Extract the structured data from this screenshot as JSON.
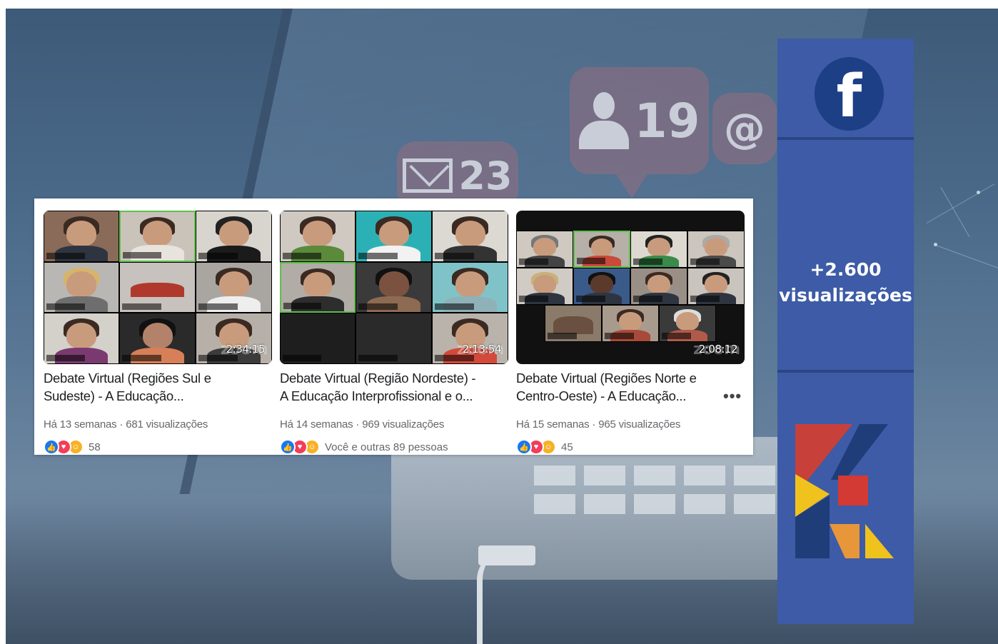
{
  "videos": [
    {
      "title_line1": "Debate Virtual (Regiões Sul e",
      "title_line2": "Sudeste) - A Educação...",
      "meta": "Há 13 semanas · 681 visualizações",
      "duration": "2:34:15",
      "reaction_count": "58"
    },
    {
      "title_line1": "Debate Virtual (Região Nordeste) -",
      "title_line2": "A Educação Interprofissional e o...",
      "meta": "Há 14 semanas · 969 visualizações",
      "duration": "2:13:54",
      "reaction_count": "Você e outras 89 pessoas"
    },
    {
      "title_line1": "Debate Virtual (Regiões Norte e",
      "title_line2": "Centro-Oeste) - A Educação...",
      "meta": "Há 15 semanas · 965 visualizações",
      "duration": "2:08:12",
      "reaction_count": "45"
    }
  ],
  "watermark": "zoom",
  "more_options": "•••",
  "bubbles": {
    "mail_count": "23",
    "friends_count": "19",
    "at_symbol": "@"
  },
  "panel": {
    "fb_letter": "f",
    "views_line1": "+2.600",
    "views_line2": "visualizações"
  },
  "colors": {
    "panel_bg": "#3d5ba6",
    "facebook_circle": "#1d3f86",
    "like": "#1877f2",
    "love": "#f33e58",
    "care": "#f7b125",
    "zoom_active_border": "#5ec04c"
  },
  "icons": [
    "facebook-icon",
    "mail-icon",
    "person-icon",
    "like-icon",
    "love-icon",
    "care-icon",
    "more-options-icon",
    "logo"
  ]
}
